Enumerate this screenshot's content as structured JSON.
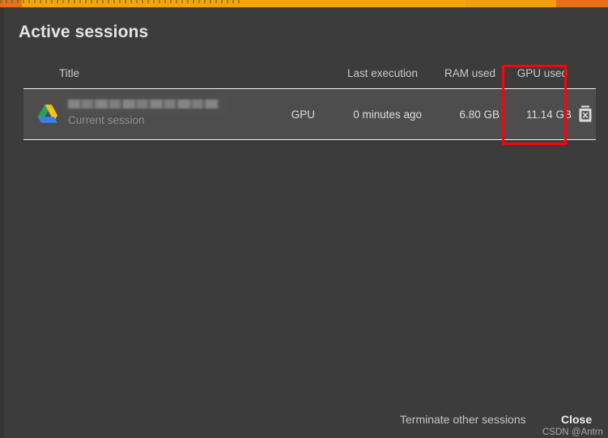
{
  "dialog": {
    "title": "Active sessions"
  },
  "table": {
    "headers": {
      "title": "Title",
      "last_execution": "Last execution",
      "ram_used": "RAM used",
      "gpu_used": "GPU used"
    },
    "rows": [
      {
        "icon": "google-drive-icon",
        "title": "",
        "subtitle": "Current session",
        "runtime_type": "GPU",
        "last_execution": "0 minutes ago",
        "ram_used": "6.80 GB",
        "gpu_used": "11.14 GB",
        "delete_icon": "trash-delete-icon"
      }
    ]
  },
  "annotation": {
    "type": "highlight-rectangle",
    "color": "#fb0404",
    "targets": "GPU used column"
  },
  "footer": {
    "terminate_label": "Terminate other sessions",
    "close_label": "Close"
  },
  "watermark": {
    "text": "CSDN @Antrn"
  },
  "colors": {
    "dialog_background": "#3c3c3c",
    "row_background": "#4d4d4d",
    "divider": "#f2f2f2",
    "accent_strip": "#f5a507",
    "accent_strip_edge": "#e8701a",
    "annotation_red": "#fb0404",
    "text_primary": "#e4e4e4",
    "text_secondary": "#c9c9c9",
    "text_muted": "#8d8d8d"
  }
}
